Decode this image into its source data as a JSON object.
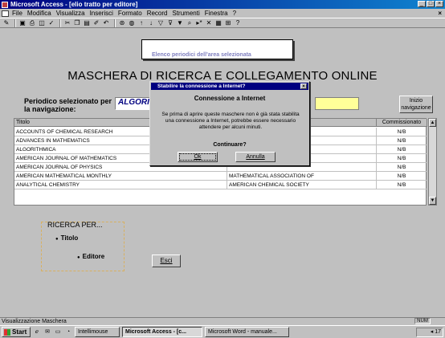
{
  "window": {
    "title": "Microsoft Access - [elio tratto per editore]"
  },
  "menu": {
    "items": [
      "File",
      "Modifica",
      "Visualizza",
      "Inserisci",
      "Formato",
      "Record",
      "Strumenti",
      "Finestra",
      "?"
    ]
  },
  "form": {
    "title": "MASCHERA DI RICERCA E COLLEGAMENTO ONLINE",
    "period_label": "Periodico selezionato per la navigazione:",
    "period_value": "ALGORIT",
    "inizio_btn": "Inizio navigazione",
    "popup_text": "Elenco periodici dell'area selezionata"
  },
  "table": {
    "headers": [
      "Titolo",
      "",
      "Commissionato"
    ],
    "rows": [
      {
        "title": "ACCOUNTS OF CHEMICAL RESEARCH",
        "editor": "",
        "flag": "N/B"
      },
      {
        "title": "ADVANCES IN MATHEMATICS",
        "editor": "",
        "flag": "N/B"
      },
      {
        "title": "ALGORITHMICA",
        "editor": "",
        "flag": "N/B"
      },
      {
        "title": "AMERICAN JOURNAL OF MATHEMATICS",
        "editor": "",
        "flag": "N/B"
      },
      {
        "title": "AMERICAN JOURNAL OF PHYSICS",
        "editor": "",
        "flag": "N/B"
      },
      {
        "title": "AMERICAN MATHEMATICAL MONTHLY",
        "editor": "MATHEMATICAL ASSOCIATION OF",
        "flag": "N/B"
      },
      {
        "title": "ANALYTICAL CHEMISTRY",
        "editor": "AMERICAN CHEMICAL SOCIETY",
        "flag": "N/B"
      }
    ]
  },
  "search": {
    "label": "RICERCA PER...",
    "option_titolo": "Titolo",
    "option_editore": "Editore"
  },
  "esci_btn": "Esci",
  "dialog": {
    "title": "Stabilire la connessione a Internet?",
    "heading": "Connessione a Internet",
    "message": "Se prima di aprire queste maschere non è già stata stabilita una connessione a Internet, potrebbe essere necessario attendere per alcuni minuti.",
    "question": "Continuare?",
    "ok": "Ok",
    "cancel": "Annulla"
  },
  "status": {
    "text": "Visualizzazione Maschera",
    "mode": "NUM"
  },
  "taskbar": {
    "start": "Start",
    "tasks": [
      "Intellimouse",
      "Microsoft Access - [c...",
      "Microsoft Word - manuale..."
    ],
    "clock": "17"
  }
}
